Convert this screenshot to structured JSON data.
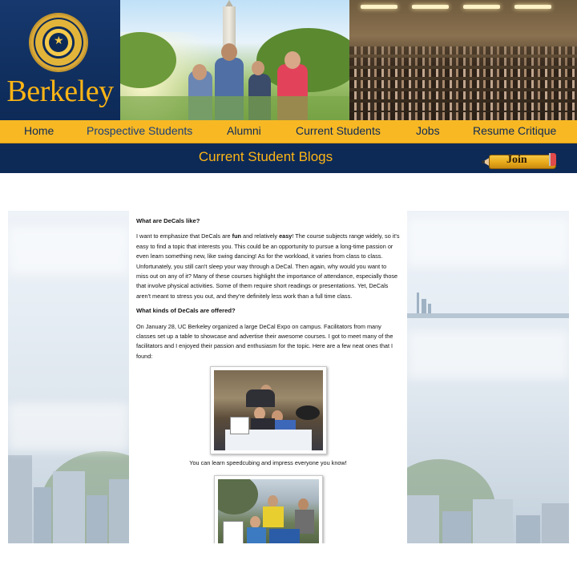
{
  "header": {
    "logo_wordmark": "Berkeley",
    "seal_text": "UNIVERSITY OF CALIFORNIA 1868"
  },
  "nav": {
    "items": [
      "Home",
      "Prospective Students",
      "Alumni",
      "Current Students",
      "Jobs",
      "Resume Critique"
    ],
    "active": "Prospective Students"
  },
  "title_bar": {
    "title": "Current Student Blogs",
    "join_label": "Join"
  },
  "article": {
    "heading1": "What are DeCals like?",
    "p1_part1": "I want to emphasize that DeCals are ",
    "p1_bold1": "fun",
    "p1_part2": " and relatively ",
    "p1_bold2": "easy",
    "p1_part3": "! The course subjects range widely, so it's easy to find a topic that interests you. This could be an opportunity to pursue a long-time passion or even learn something new, like swing dancing! As for the workload, it varies from class to class. Unfortunately, you still can't sleep your way through a DeCal. Then again, why would you want to miss out on any of it? Many of these courses highlight the importance of attendance, especially those that involve physical activities. Some of them require short readings or presentations. Yet, DeCals aren't meant to stress you out, and they're definitely less work than a full time class.",
    "heading2": "What kinds of DeCals are offered?",
    "p2": "On January 28, UC Berkeley organized a large DeCal Expo on campus. Facilitators from many classes set up a table to showcase and advertise their awesome courses. I got to meet many of the facilitators and I enjoyed their passion and enthusiasm for the topic. Here are a few neat ones that I found:",
    "caption1": "You can learn speedcubing and impress everyone you know!"
  },
  "colors": {
    "navy": "#0d2a57",
    "gold": "#fdb515",
    "nav_bar": "#f7b824"
  }
}
